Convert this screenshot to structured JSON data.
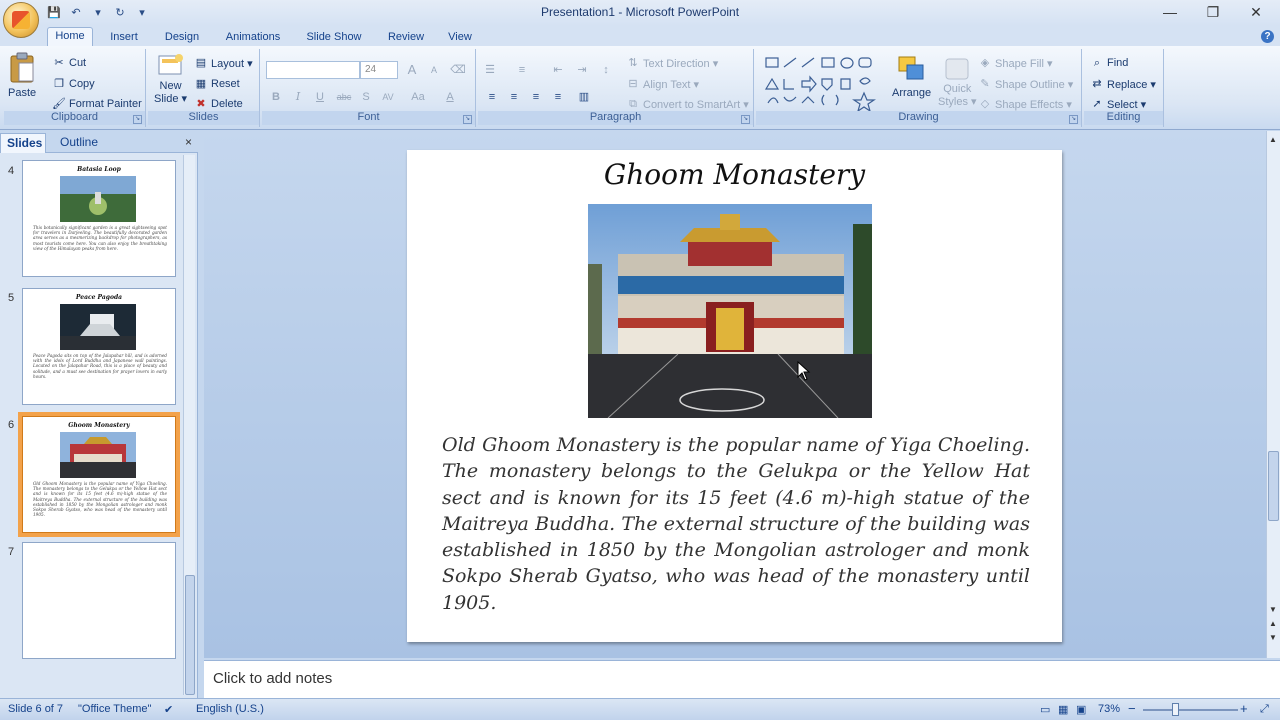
{
  "window": {
    "title": "Presentation1 - Microsoft PowerPoint",
    "minimize": "—",
    "restore": "❐",
    "close": "✕"
  },
  "qat": {
    "save": "💾",
    "undo": "↶",
    "undo_menu": "▾",
    "redo": "↻",
    "customize": "▾"
  },
  "tabs": [
    "Home",
    "Insert",
    "Design",
    "Animations",
    "Slide Show",
    "Review",
    "View"
  ],
  "ribbon": {
    "clipboard": {
      "label": "Clipboard",
      "paste": "Paste",
      "cut": "Cut",
      "copy": "Copy",
      "format_painter": "Format Painter"
    },
    "slides": {
      "label": "Slides",
      "new_slide_line1": "New",
      "new_slide_line2": "Slide ▾",
      "layout": "Layout ▾",
      "reset": "Reset",
      "delete": "Delete"
    },
    "font": {
      "label": "Font",
      "font_size": "24",
      "bold": "B",
      "italic": "I",
      "underline": "U",
      "strike": "abc",
      "shadow": "S",
      "spacing": "AV",
      "case": "Aa",
      "color": "A",
      "grow": "A",
      "shrink": "A"
    },
    "paragraph": {
      "label": "Paragraph",
      "text_direction": "Text Direction ▾",
      "align_text": "Align Text ▾",
      "convert_smartart": "Convert to SmartArt ▾"
    },
    "drawing": {
      "label": "Drawing",
      "arrange": "Arrange",
      "quick_styles_line1": "Quick",
      "quick_styles_line2": "Styles ▾",
      "shape_fill": "Shape Fill ▾",
      "shape_outline": "Shape Outline ▾",
      "shape_effects": "Shape Effects ▾"
    },
    "editing": {
      "label": "Editing",
      "find": "Find",
      "replace": "Replace ▾",
      "select": "Select ▾"
    }
  },
  "left_pane": {
    "tab_slides": "Slides",
    "tab_outline": "Outline",
    "close": "×",
    "thumbs": [
      {
        "num": "4",
        "title": "Batasia Loop",
        "text": "This botanically significant garden is a great sightseeing spot for travelers in Darjeeling. The beautifully decorated garden area serves as a mesmerizing backdrop for photographers, as most tourists come here. You can also enjoy the breathtaking view of the Himalayan peaks from here."
      },
      {
        "num": "5",
        "title": "Peace Pagoda",
        "text": "Peace Pagoda sits on top of the Jalapahar hill, and is adorned with the idols of Lord Buddha and Japanese wall paintings. Located on the Jalapahar Road, this is a place of beauty and solitude, and a must see destination for prayer lovers in early hours."
      },
      {
        "num": "6",
        "title": "Ghoom Monastery",
        "text": "Old Ghoom Monastery is the popular name of Yiga Choeling. The monastery belongs to the Gelukpa or the Yellow Hat sect and is known for its 15 feet (4.6 m)-high statue of the Maitreya Buddha. The external structure of the building was established in 1850 by the Mongolian astrologer and monk Sokpo Sherab Gyatso, who was head of the monastery until 1905."
      },
      {
        "num": "7",
        "title": "",
        "text": ""
      }
    ]
  },
  "slide": {
    "title": "Ghoom Monastery",
    "body": "Old Ghoom Monastery is the popular name of Yiga Choeling. The monastery belongs to the Gelukpa or the Yellow Hat sect and is known for its 15 feet (4.6 m)-high statue of the Maitreya Buddha. The external structure of the building was established in 1850 by the Mongolian astrologer and monk Sokpo Sherab Gyatso, who was head of the monastery until 1905."
  },
  "notes": {
    "placeholder": "Click to add notes"
  },
  "status": {
    "slide_info": "Slide 6 of 7",
    "theme": "\"Office Theme\"",
    "language": "English (U.S.)",
    "zoom": "73%",
    "zoom_out": "−",
    "zoom_in": "+"
  }
}
